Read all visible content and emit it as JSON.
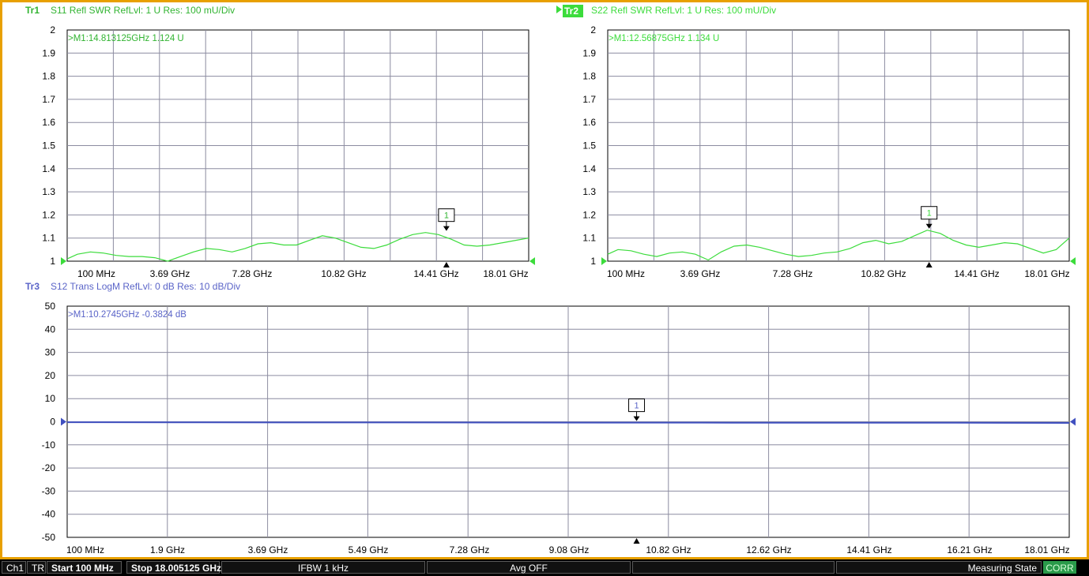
{
  "colors": {
    "tr1": "#3cdc3c",
    "tr1_label": "#32b432",
    "tr2": "#3cdc3c",
    "tr3": "#4050c0",
    "tr3_label": "#5a64c8",
    "grid": "#8c8ca0",
    "frame": "#e8a000",
    "status_bg": "#000000",
    "corr_bg": "#2a9a4a"
  },
  "chart_data": [
    {
      "id": "tr1",
      "type": "line",
      "trace_label": "Tr1",
      "header": "S11 Refl SWR RefLvl: 1  U Res: 100 mU/Div",
      "marker_text": ">M1:14.813125GHz  1.124  U",
      "marker_number": "1",
      "marker_x": 14.813125,
      "marker_y": 1.124,
      "ylim": [
        1,
        2
      ],
      "y_ticks": [
        "2",
        "1.9",
        "1.8",
        "1.7",
        "1.6",
        "1.5",
        "1.4",
        "1.3",
        "1.2",
        "1.1",
        "1"
      ],
      "xlim": [
        0.1,
        18.005125
      ],
      "x_tick_labels": [
        "100 MHz",
        "3.69 GHz",
        "7.28 GHz",
        "10.82 GHz",
        "14.41 GHz",
        "18.01 GHz"
      ],
      "series": [
        {
          "x": [
            0.1,
            0.5,
            1,
            1.5,
            2,
            2.5,
            3,
            3.5,
            4,
            4.5,
            5,
            5.5,
            6,
            6.5,
            7,
            7.5,
            8,
            8.5,
            9,
            9.5,
            10,
            10.5,
            11,
            11.5,
            12,
            12.5,
            13,
            13.5,
            14,
            14.5,
            15,
            15.5,
            16,
            16.5,
            17,
            17.5,
            18.005
          ],
          "y": [
            1.01,
            1.03,
            1.04,
            1.035,
            1.025,
            1.02,
            1.02,
            1.015,
            1.0,
            1.02,
            1.04,
            1.055,
            1.05,
            1.04,
            1.055,
            1.075,
            1.08,
            1.07,
            1.07,
            1.09,
            1.11,
            1.1,
            1.08,
            1.06,
            1.055,
            1.07,
            1.095,
            1.115,
            1.124,
            1.115,
            1.095,
            1.07,
            1.065,
            1.07,
            1.08,
            1.09,
            1.1
          ]
        }
      ]
    },
    {
      "id": "tr2",
      "type": "line",
      "trace_label": "Tr2",
      "header": "S22 Refl SWR RefLvl: 1  U Res: 100 mU/Div",
      "marker_text": ">M1:12.56875GHz  1.134  U",
      "marker_number": "1",
      "marker_x": 12.56875,
      "marker_y": 1.134,
      "ylim": [
        1,
        2
      ],
      "y_ticks": [
        "2",
        "1.9",
        "1.8",
        "1.7",
        "1.6",
        "1.5",
        "1.4",
        "1.3",
        "1.2",
        "1.1",
        "1"
      ],
      "xlim": [
        0.1,
        18.005125
      ],
      "x_tick_labels": [
        "100 MHz",
        "3.69 GHz",
        "7.28 GHz",
        "10.82 GHz",
        "14.41 GHz",
        "18.01 GHz"
      ],
      "series": [
        {
          "x": [
            0.1,
            0.5,
            1,
            1.5,
            2,
            2.5,
            3,
            3.5,
            4,
            4.5,
            5,
            5.5,
            6,
            6.5,
            7,
            7.5,
            8,
            8.5,
            9,
            9.5,
            10,
            10.5,
            11,
            11.5,
            12,
            12.5,
            13,
            13.5,
            14,
            14.5,
            15,
            15.5,
            16,
            16.5,
            17,
            17.5,
            18.005
          ],
          "y": [
            1.03,
            1.05,
            1.045,
            1.03,
            1.02,
            1.035,
            1.04,
            1.03,
            1.005,
            1.04,
            1.065,
            1.07,
            1.06,
            1.045,
            1.03,
            1.02,
            1.025,
            1.035,
            1.04,
            1.055,
            1.08,
            1.09,
            1.075,
            1.085,
            1.11,
            1.134,
            1.12,
            1.09,
            1.07,
            1.06,
            1.07,
            1.08,
            1.075,
            1.055,
            1.035,
            1.05,
            1.1
          ]
        }
      ]
    },
    {
      "id": "tr3",
      "type": "line",
      "trace_label": "Tr3",
      "header": "S12 Trans LogM RefLvl: 0  dB Res: 10  dB/Div",
      "marker_text": ">M1:10.2745GHz  -0.3824  dB",
      "marker_number": "1",
      "marker_x": 10.2745,
      "marker_y": -0.3824,
      "ylim": [
        -50,
        50
      ],
      "y_ticks": [
        "50",
        "40",
        "30",
        "20",
        "10",
        "0",
        "-10",
        "-20",
        "-30",
        "-40",
        "-50"
      ],
      "xlim": [
        0.1,
        18.005125
      ],
      "x_tick_labels": [
        "100 MHz",
        "1.9 GHz",
        "3.69 GHz",
        "5.49 GHz",
        "7.28 GHz",
        "9.08 GHz",
        "10.82 GHz",
        "12.62 GHz",
        "14.41 GHz",
        "16.21 GHz",
        "18.01 GHz"
      ],
      "series": [
        {
          "x": [
            0.1,
            2,
            4,
            6,
            8,
            10,
            12,
            14,
            16,
            18.005
          ],
          "y": [
            -0.2,
            -0.25,
            -0.3,
            -0.3,
            -0.35,
            -0.38,
            -0.4,
            -0.42,
            -0.45,
            -0.5
          ]
        }
      ]
    }
  ],
  "status": {
    "channel": "Ch1",
    "mode": "TR",
    "start": "Start 100 MHz",
    "stop": "Stop 18.005125 GHz",
    "ifbw": "IFBW 1 kHz",
    "avg": "Avg OFF",
    "state": "Measuring State",
    "corr": "CORR"
  }
}
